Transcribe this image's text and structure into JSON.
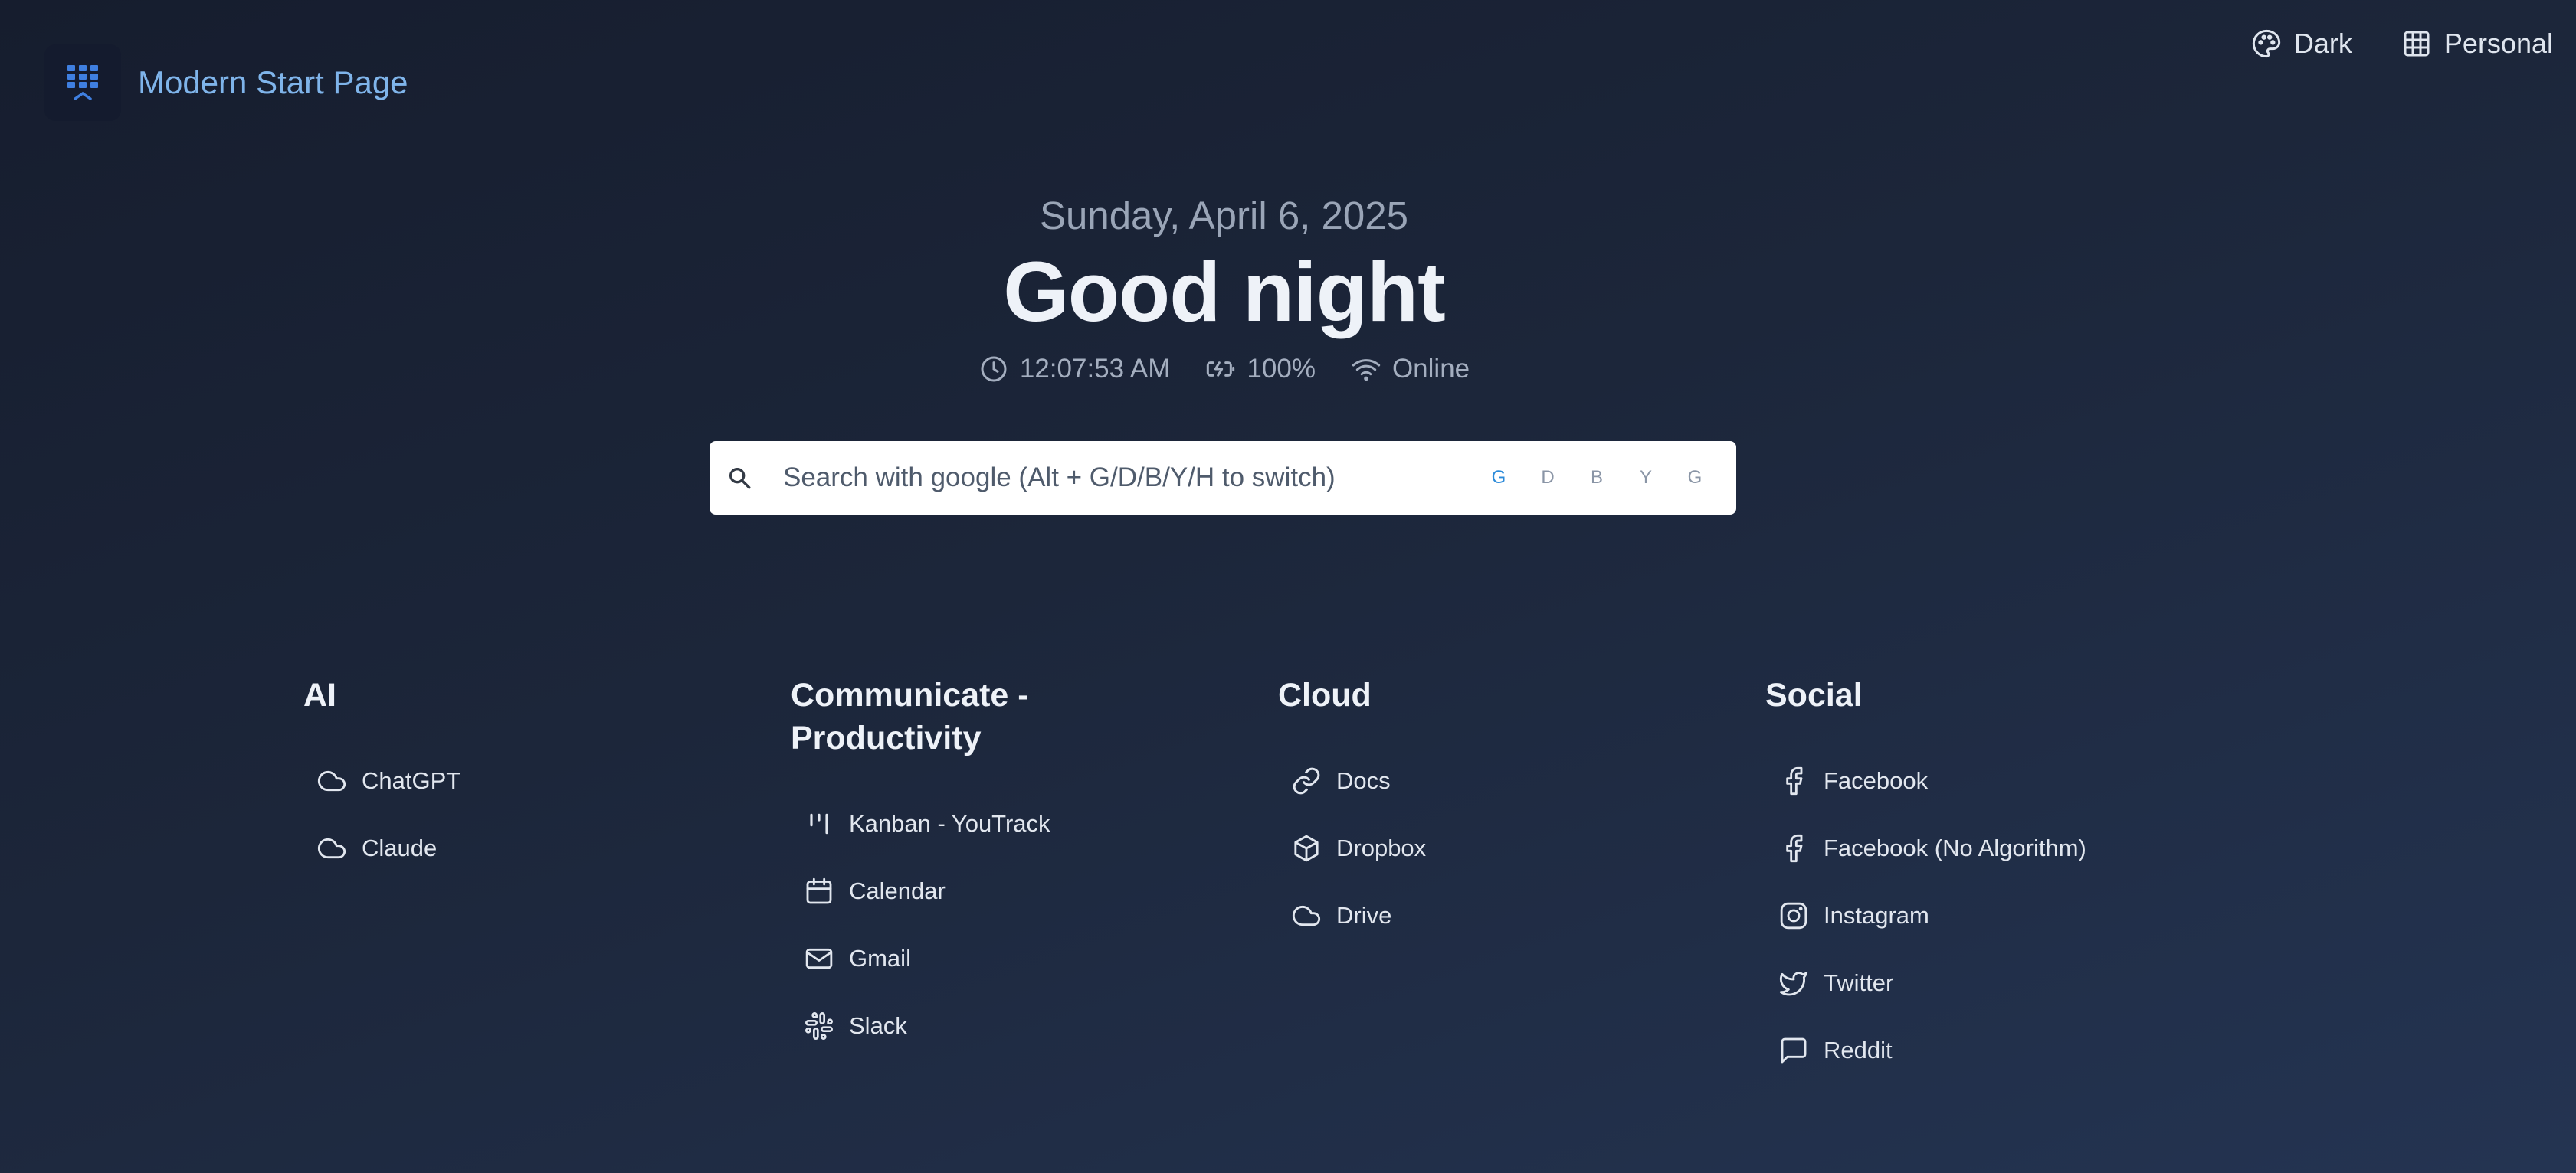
{
  "app": {
    "title": "Modern Start Page"
  },
  "header": {
    "theme_label": "Dark",
    "profile_label": "Personal"
  },
  "hero": {
    "date": "Sunday, April 6, 2025",
    "greeting": "Good night",
    "time": "12:07:53 AM",
    "battery": "100%",
    "network": "Online"
  },
  "search": {
    "placeholder": "Search with google (Alt + G/D/B/Y/H to switch)",
    "engines": [
      "G",
      "D",
      "B",
      "Y",
      "G"
    ],
    "active_engine": "G"
  },
  "sections": [
    {
      "title": "AI",
      "items": [
        {
          "label": "ChatGPT",
          "icon": "cloud-icon"
        },
        {
          "label": "Claude",
          "icon": "cloud-icon"
        }
      ]
    },
    {
      "title": "Communicate - Productivity",
      "items": [
        {
          "label": "Kanban - YouTrack",
          "icon": "kanban-icon"
        },
        {
          "label": "Calendar",
          "icon": "calendar-icon"
        },
        {
          "label": "Gmail",
          "icon": "mail-icon"
        },
        {
          "label": "Slack",
          "icon": "slack-icon"
        }
      ]
    },
    {
      "title": "Cloud",
      "items": [
        {
          "label": "Docs",
          "icon": "link-icon"
        },
        {
          "label": "Dropbox",
          "icon": "box-icon"
        },
        {
          "label": "Drive",
          "icon": "cloud-icon"
        }
      ]
    },
    {
      "title": "Social",
      "items": [
        {
          "label": "Facebook",
          "icon": "facebook-icon"
        },
        {
          "label": "Facebook (No Algorithm)",
          "icon": "facebook-icon"
        },
        {
          "label": "Instagram",
          "icon": "instagram-icon"
        },
        {
          "label": "Twitter",
          "icon": "twitter-icon"
        },
        {
          "label": "Reddit",
          "icon": "message-icon"
        }
      ]
    }
  ],
  "colors": {
    "accent": "#7fb4ea",
    "active_engine": "#2b8ad9",
    "background": "#1c263a"
  }
}
